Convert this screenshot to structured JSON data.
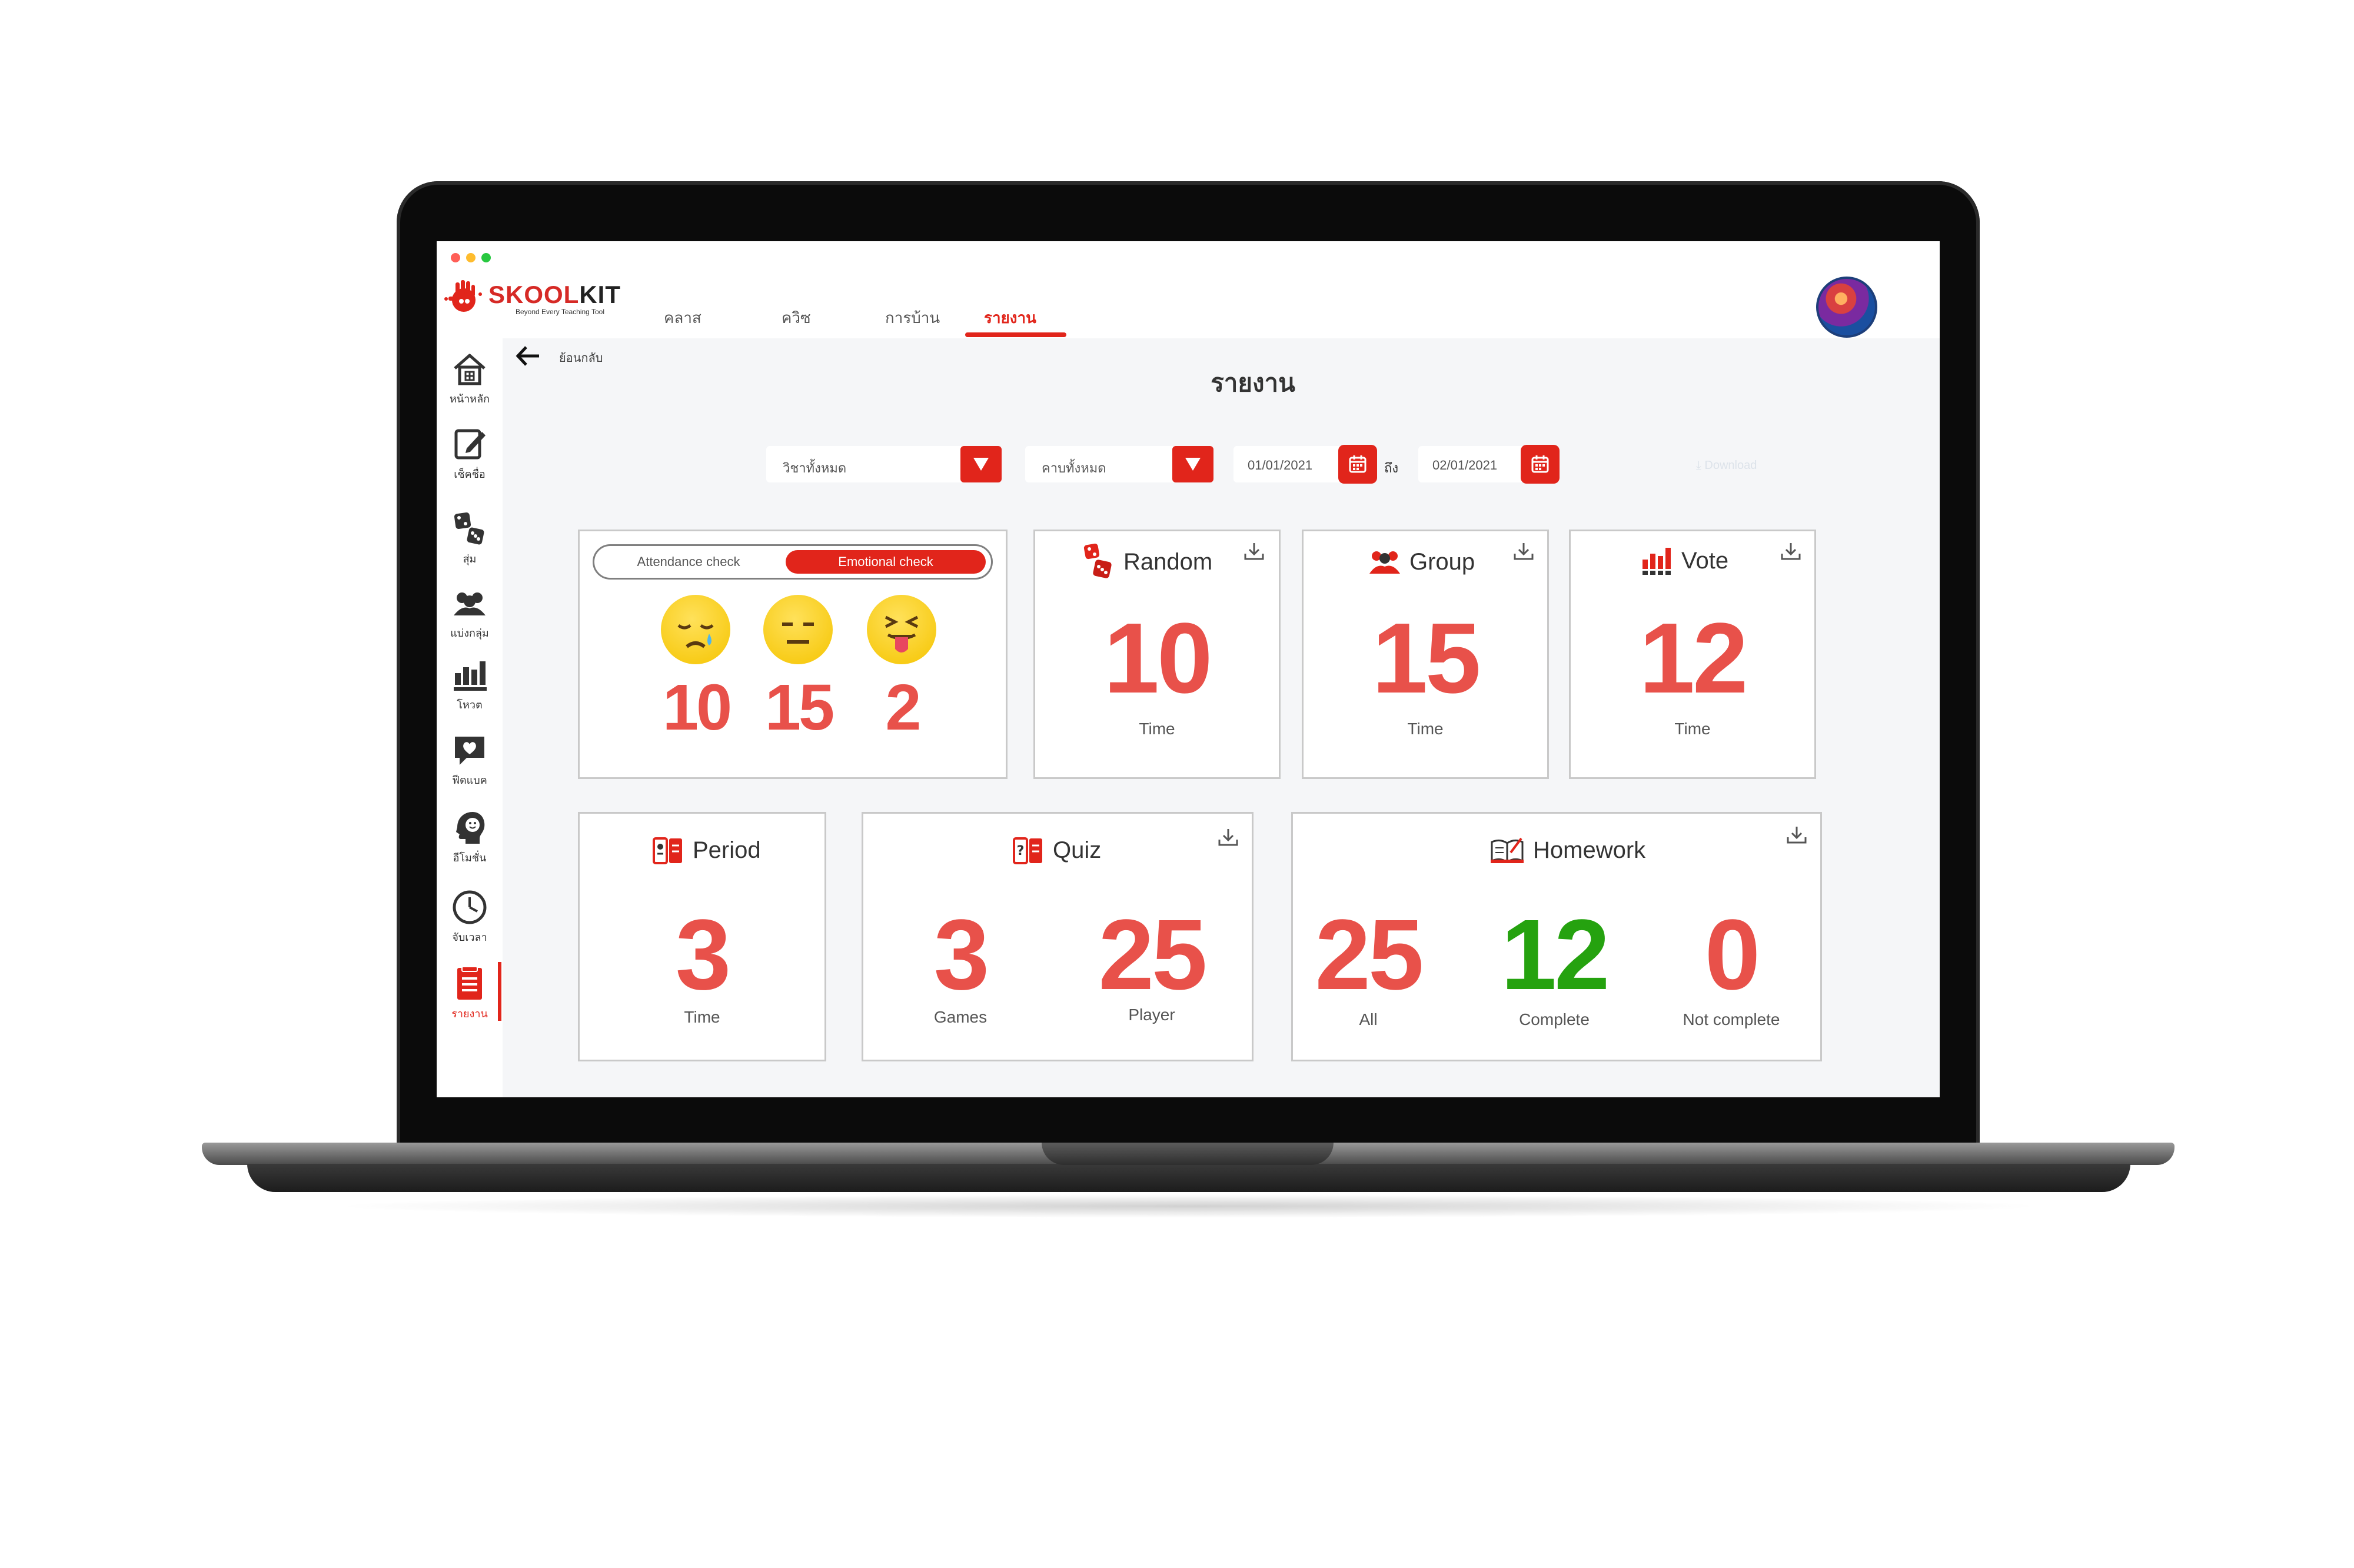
{
  "app": {
    "brand_name_a": "SKOOL",
    "brand_name_b": "KIT",
    "brand_tagline": "Beyond Every Teaching Tool",
    "accent_color": "#e1251b"
  },
  "nav": {
    "tabs": [
      {
        "label": "คลาส"
      },
      {
        "label": "ควิซ"
      },
      {
        "label": "การบ้าน"
      },
      {
        "label": "รายงาน",
        "active": true
      }
    ]
  },
  "sidebar": {
    "items": [
      {
        "label": "หน้าหลัก",
        "icon": "home-icon"
      },
      {
        "label": "เช็คชื่อ",
        "icon": "checklist-icon"
      },
      {
        "label": "สุ่ม",
        "icon": "dice-icon"
      },
      {
        "label": "แบ่งกลุ่ม",
        "icon": "group-icon"
      },
      {
        "label": "โหวต",
        "icon": "vote-icon"
      },
      {
        "label": "ฟีดแบค",
        "icon": "feedback-icon"
      },
      {
        "label": "อีโมชั่น",
        "icon": "emotion-icon"
      },
      {
        "label": "จับเวลา",
        "icon": "clock-icon"
      },
      {
        "label": "รายงาน",
        "icon": "report-icon",
        "active": true
      }
    ]
  },
  "page": {
    "back_label": "ย้อนกลับ",
    "title": "รายงาน"
  },
  "filters": {
    "subject_value": "วิชาทั้งหมด",
    "period_value": "คาบทั้งหมด",
    "date_from": "01/01/2021",
    "date_to_label": "ถึง",
    "date_to": "02/01/2021",
    "download_label": "Download"
  },
  "emotion_card": {
    "toggle_left": "Attendance check",
    "toggle_right": "Emotional check",
    "values": [
      "10",
      "15",
      "2"
    ]
  },
  "random_card": {
    "title": "Random",
    "value": "10",
    "unit": "Time"
  },
  "group_card": {
    "title": "Group",
    "value": "15",
    "unit": "Time"
  },
  "vote_card": {
    "title": "Vote",
    "value": "12",
    "unit": "Time"
  },
  "period_card": {
    "title": "Period",
    "value": "3",
    "unit": "Time"
  },
  "quiz_card": {
    "title": "Quiz",
    "games_value": "3",
    "games_label": "Games",
    "player_value": "25",
    "player_label": "Player"
  },
  "homework_card": {
    "title": "Homework",
    "all_value": "25",
    "all_label": "All",
    "complete_value": "12",
    "complete_label": "Complete",
    "not_complete_value": "0",
    "not_complete_label": "Not complete"
  }
}
